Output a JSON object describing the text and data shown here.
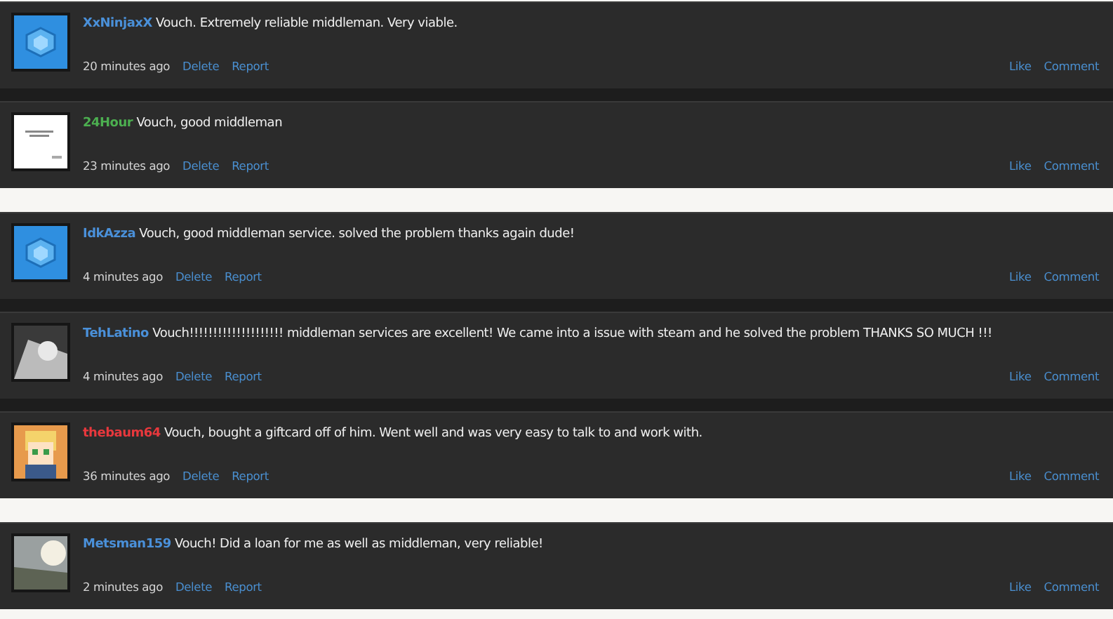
{
  "groups": [
    {
      "posts": [
        {
          "author": "XxNinjaxX",
          "color": "#4a90d9",
          "kind": "cube",
          "text": "Vouch. Extremely reliable middleman. Very viable.",
          "time": "20 minutes ago",
          "actions": [
            "Delete",
            "Report"
          ],
          "social": [
            "Like",
            "Comment"
          ]
        },
        {
          "author": "24Hour",
          "color": "#4caf50",
          "kind": "note",
          "text": "Vouch, good middleman",
          "time": "23 minutes ago",
          "actions": [
            "Delete",
            "Report"
          ],
          "social": [
            "Like",
            "Comment"
          ]
        }
      ]
    },
    {
      "posts": [
        {
          "author": "IdkAzza",
          "color": "#4a90d9",
          "kind": "cube",
          "text": "Vouch, good middleman service. solved the problem thanks again dude!",
          "time": "4 minutes ago",
          "actions": [
            "Delete",
            "Report"
          ],
          "social": [
            "Like",
            "Comment"
          ]
        },
        {
          "author": "TehLatino",
          "color": "#4a90d9",
          "kind": "mono",
          "text": "Vouch!!!!!!!!!!!!!!!!!!!! middleman services are excellent! We came into a issue with steam and he solved the problem THANKS SO MUCH !!!",
          "time": "4 minutes ago",
          "actions": [
            "Delete",
            "Report"
          ],
          "social": [
            "Like",
            "Comment"
          ]
        },
        {
          "author": "thebaum64",
          "color": "#e8383d",
          "kind": "pixel",
          "text": "Vouch, bought a giftcard off of him. Went well and was very easy to talk to and work with.",
          "time": "36 minutes ago",
          "actions": [
            "Delete",
            "Report"
          ],
          "social": [
            "Like",
            "Comment"
          ]
        }
      ]
    },
    {
      "posts": [
        {
          "author": "Metsman159",
          "color": "#4a90d9",
          "kind": "photo",
          "text": "Vouch! Did a loan for me as well as middleman, very reliable!",
          "time": "2 minutes ago",
          "actions": [
            "Delete",
            "Report"
          ],
          "social": [
            "Like",
            "Comment"
          ]
        }
      ]
    }
  ]
}
